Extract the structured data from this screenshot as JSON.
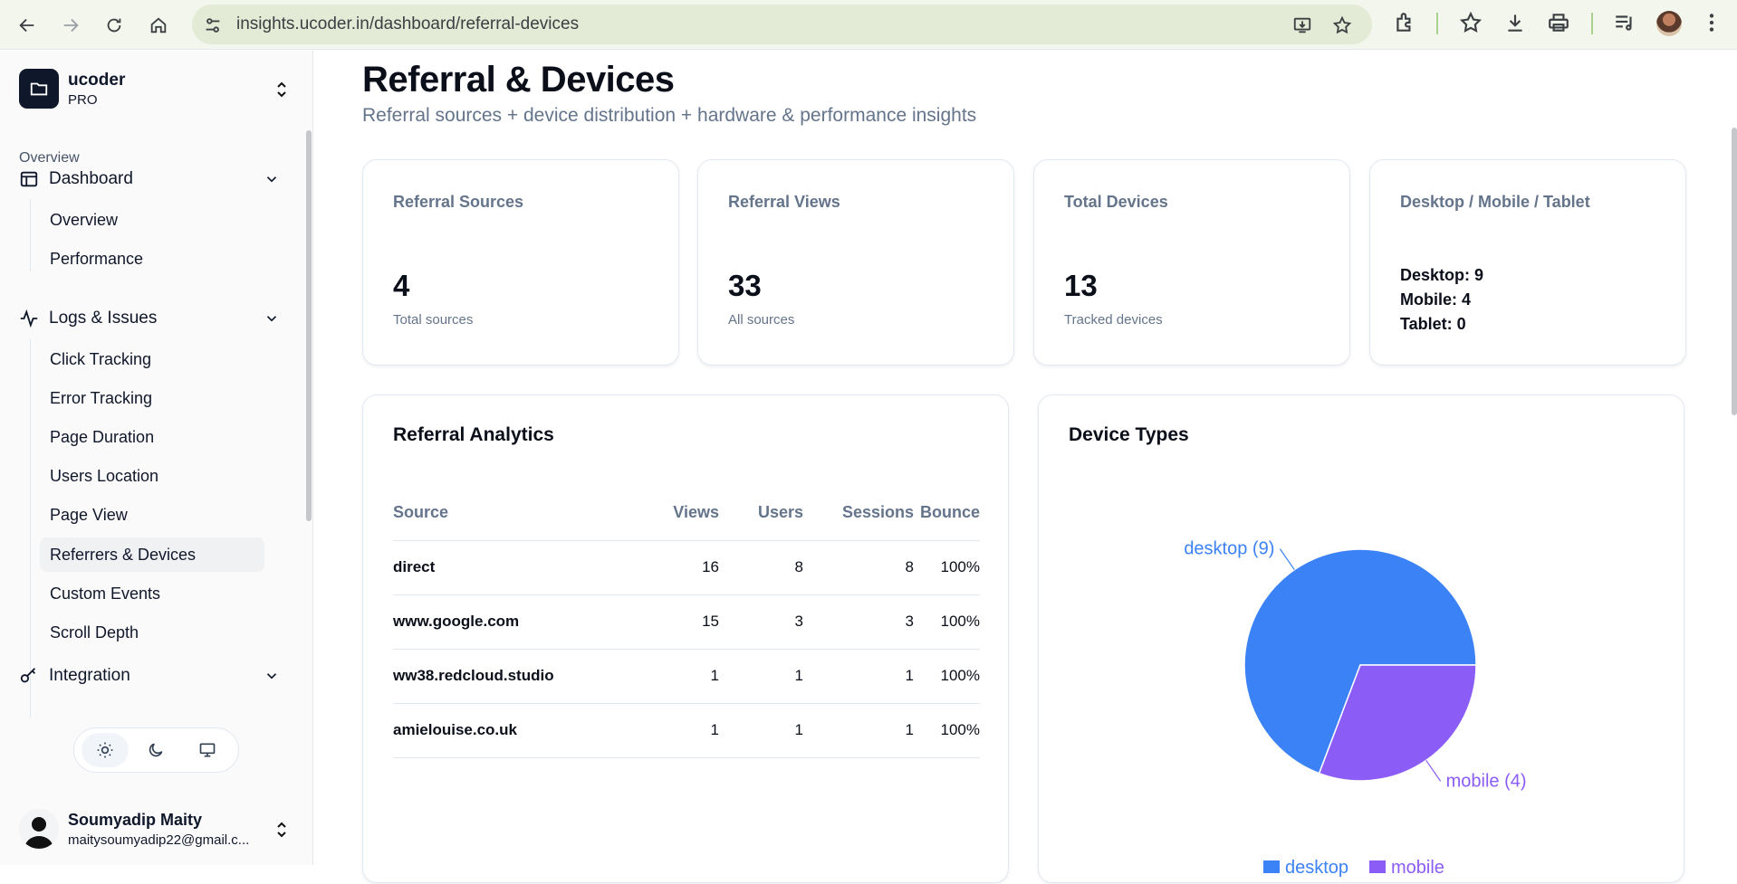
{
  "browser": {
    "url": "insights.ucoder.in/dashboard/referral-devices"
  },
  "sidebar": {
    "org_name": "ucoder",
    "org_plan": "PRO",
    "section_label": "Overview",
    "groups": [
      {
        "label": "Dashboard",
        "items": [
          "Overview",
          "Performance"
        ]
      },
      {
        "label": "Logs & Issues",
        "items": [
          "Click Tracking",
          "Error Tracking",
          "Page Duration",
          "Users Location",
          "Page View",
          "Referrers & Devices",
          "Custom Events",
          "Scroll Depth"
        ]
      },
      {
        "label": "Integration",
        "items": []
      }
    ],
    "user": {
      "name": "Soumyadip Maity",
      "email": "maitysoumyadip22@gmail.c..."
    }
  },
  "page": {
    "title": "Referral & Devices",
    "subtitle": "Referral sources + device distribution + hardware & performance insights"
  },
  "stats": [
    {
      "label": "Referral Sources",
      "value": "4",
      "note": "Total sources"
    },
    {
      "label": "Referral Views",
      "value": "33",
      "note": "All sources"
    },
    {
      "label": "Total Devices",
      "value": "13",
      "note": "Tracked devices"
    },
    {
      "label": "Desktop / Mobile / Tablet",
      "lines": [
        "Desktop: 9",
        "Mobile: 4",
        "Tablet: 0"
      ]
    }
  ],
  "referral": {
    "title": "Referral Analytics",
    "columns": [
      "Source",
      "Views",
      "Users",
      "Sessions",
      "Bounce"
    ],
    "rows": [
      [
        "direct",
        "16",
        "8",
        "8",
        "100%"
      ],
      [
        "www.google.com",
        "15",
        "3",
        "3",
        "100%"
      ],
      [
        "ww38.redcloud.studio",
        "1",
        "1",
        "1",
        "100%"
      ],
      [
        "amielouise.co.uk",
        "1",
        "1",
        "1",
        "100%"
      ]
    ]
  },
  "devices_panel": {
    "title": "Device Types"
  },
  "chart_data": {
    "type": "pie",
    "title": "",
    "slices": [
      {
        "name": "desktop",
        "value": 9,
        "label": "desktop (9)",
        "color": "#3b82f6"
      },
      {
        "name": "mobile",
        "value": 4,
        "label": "mobile (4)",
        "color": "#8b5cf6"
      }
    ],
    "legend": [
      "desktop",
      "mobile"
    ],
    "legend_position": "bottom"
  }
}
